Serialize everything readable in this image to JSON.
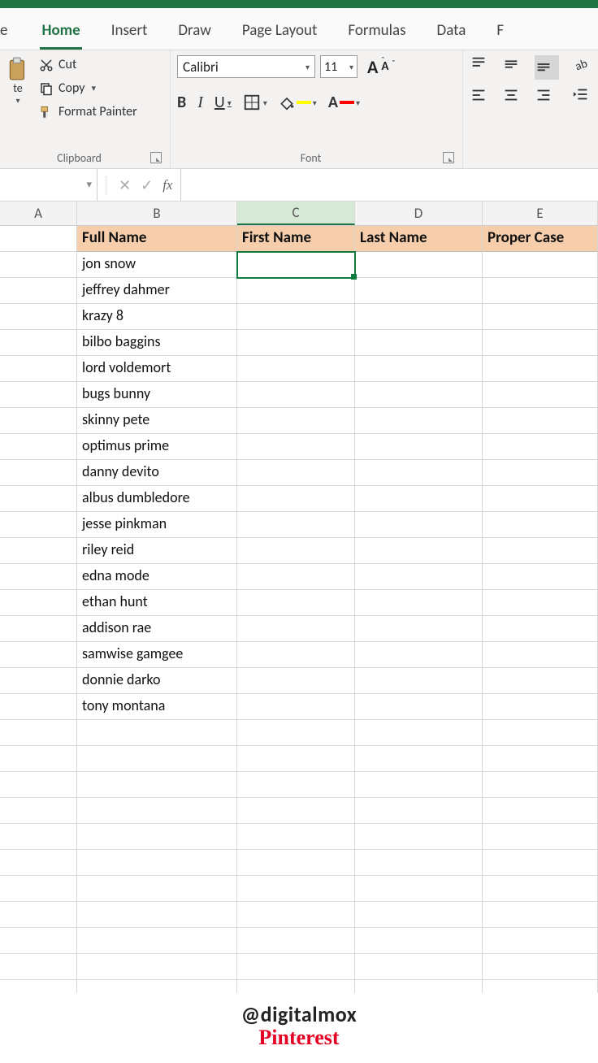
{
  "tabs": {
    "file": "e",
    "home": "Home",
    "insert": "Insert",
    "draw": "Draw",
    "pagelayout": "Page Layout",
    "formulas": "Formulas",
    "data": "Data",
    "last": "F"
  },
  "clipboard": {
    "cut": "Cut",
    "copy": "Copy",
    "format_painter": "Format Painter",
    "paste": "te",
    "group_label": "Clipboard"
  },
  "font": {
    "name": "Calibri",
    "size": "11",
    "bold": "B",
    "italic": "I",
    "underline": "U",
    "group_label": "Font",
    "bigA": "A",
    "smallA": "A",
    "colorA": "A"
  },
  "formula": {
    "fx": "fx",
    "cancel": "✕",
    "enter": "✓"
  },
  "columns": {
    "A": "A",
    "B": "B",
    "C": "C",
    "D": "D",
    "E": "E"
  },
  "headers": {
    "full": "Full Name",
    "first": "First Name",
    "last": "Last Name",
    "proper": "Proper Case"
  },
  "names": [
    "jon snow",
    "jeffrey dahmer",
    "krazy 8",
    "bilbo baggins",
    "lord voldemort",
    "bugs bunny",
    "skinny pete",
    "optimus prime",
    "danny devito",
    "albus dumbledore",
    "jesse pinkman",
    "riley reid",
    "edna mode",
    "ethan hunt",
    "addison rae",
    "samwise gamgee",
    "donnie darko",
    "tony montana"
  ],
  "footer": {
    "handle": "@digitalmox",
    "brand": "Pinterest"
  }
}
